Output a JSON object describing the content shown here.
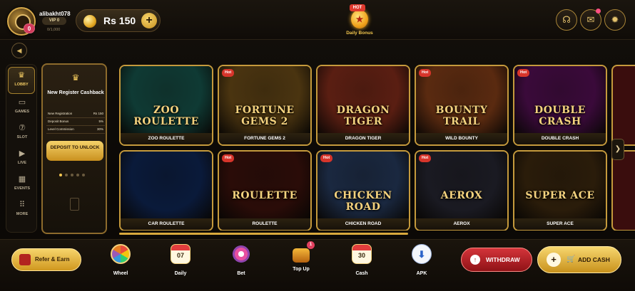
{
  "header": {
    "username": "alibakht078",
    "avatar_badge": "0",
    "vip_level": "VIP 0",
    "vip_progress": "0/1,000",
    "currency": "Rs",
    "balance": "150",
    "daily_bonus": {
      "flag": "HOT",
      "label": "Daily Bonus"
    },
    "icons": [
      "headset-icon",
      "mail-icon",
      "gear-icon"
    ]
  },
  "sidebar": {
    "items": [
      {
        "label": "LOBBY",
        "icon": "crown-icon",
        "glyph": "♛"
      },
      {
        "label": "GAMES",
        "icon": "games-icon",
        "glyph": "▭"
      },
      {
        "label": "SLOT",
        "icon": "slot-icon",
        "glyph": "⑦"
      },
      {
        "label": "LIVE",
        "icon": "live-icon",
        "glyph": "▶"
      },
      {
        "label": "EVENTS",
        "icon": "calendar-icon",
        "glyph": "▦"
      },
      {
        "label": "MORE",
        "icon": "more-icon",
        "glyph": "⠿"
      }
    ]
  },
  "promo": {
    "title": "New Register Cashback",
    "rows": [
      {
        "label": "New Registration",
        "value": "Rs 150"
      },
      {
        "label": "Deposit Bonus",
        "value": "5%"
      },
      {
        "label": "Level Commission",
        "value": "30%"
      }
    ],
    "cta": "DEPOSIT TO UNLOCK"
  },
  "games": [
    {
      "name": "ZOO ROULETTE",
      "logo": "ZOO ROULETTE",
      "hot": false,
      "bg": "#0f3a34"
    },
    {
      "name": "FORTUNE GEMS 2",
      "logo": "FORTUNE GEMS 2",
      "hot": true,
      "bg": "#4a3410"
    },
    {
      "name": "DRAGON TIGER",
      "logo": "DRAGON TIGER",
      "hot": false,
      "bg": "#5a1e12"
    },
    {
      "name": "WILD BOUNTY",
      "logo": "BOUNTY TRAIL",
      "hot": true,
      "bg": "#5a2a10"
    },
    {
      "name": "DOUBLE CRASH",
      "logo": "DOUBLE CRASH",
      "hot": true,
      "bg": "#3a0a3a"
    },
    {
      "name": "CAR ROULETTE",
      "logo": "",
      "hot": false,
      "bg": "#0a1a3a"
    },
    {
      "name": "ROULETTE",
      "logo": "ROULETTE",
      "hot": true,
      "bg": "#2a0c08"
    },
    {
      "name": "CHICKEN ROAD",
      "logo": "CHICKEN ROAD",
      "hot": true,
      "bg": "#1a2840"
    },
    {
      "name": "AEROX",
      "logo": "AEROX",
      "hot": true,
      "bg": "#1a1a22"
    },
    {
      "name": "SUPER ACE",
      "logo": "SUPER ACE",
      "hot": false,
      "bg": "#2a1c0a"
    }
  ],
  "hot_label": "Hot",
  "bottom": {
    "refer": "Refer & Earn",
    "dock": [
      {
        "label": "Wheel",
        "icon": "wheel-icon"
      },
      {
        "label": "Daily",
        "icon": "calendar-icon",
        "text": "07"
      },
      {
        "label": "Bet",
        "icon": "bet-icon"
      },
      {
        "label": "Top Up",
        "icon": "treasure-icon",
        "badge": "1"
      },
      {
        "label": "Cash",
        "icon": "cash-calendar-icon",
        "text": "30"
      },
      {
        "label": "APK",
        "icon": "download-icon"
      }
    ],
    "withdraw": "WITHDRAW",
    "add_cash": "ADD CASH"
  }
}
